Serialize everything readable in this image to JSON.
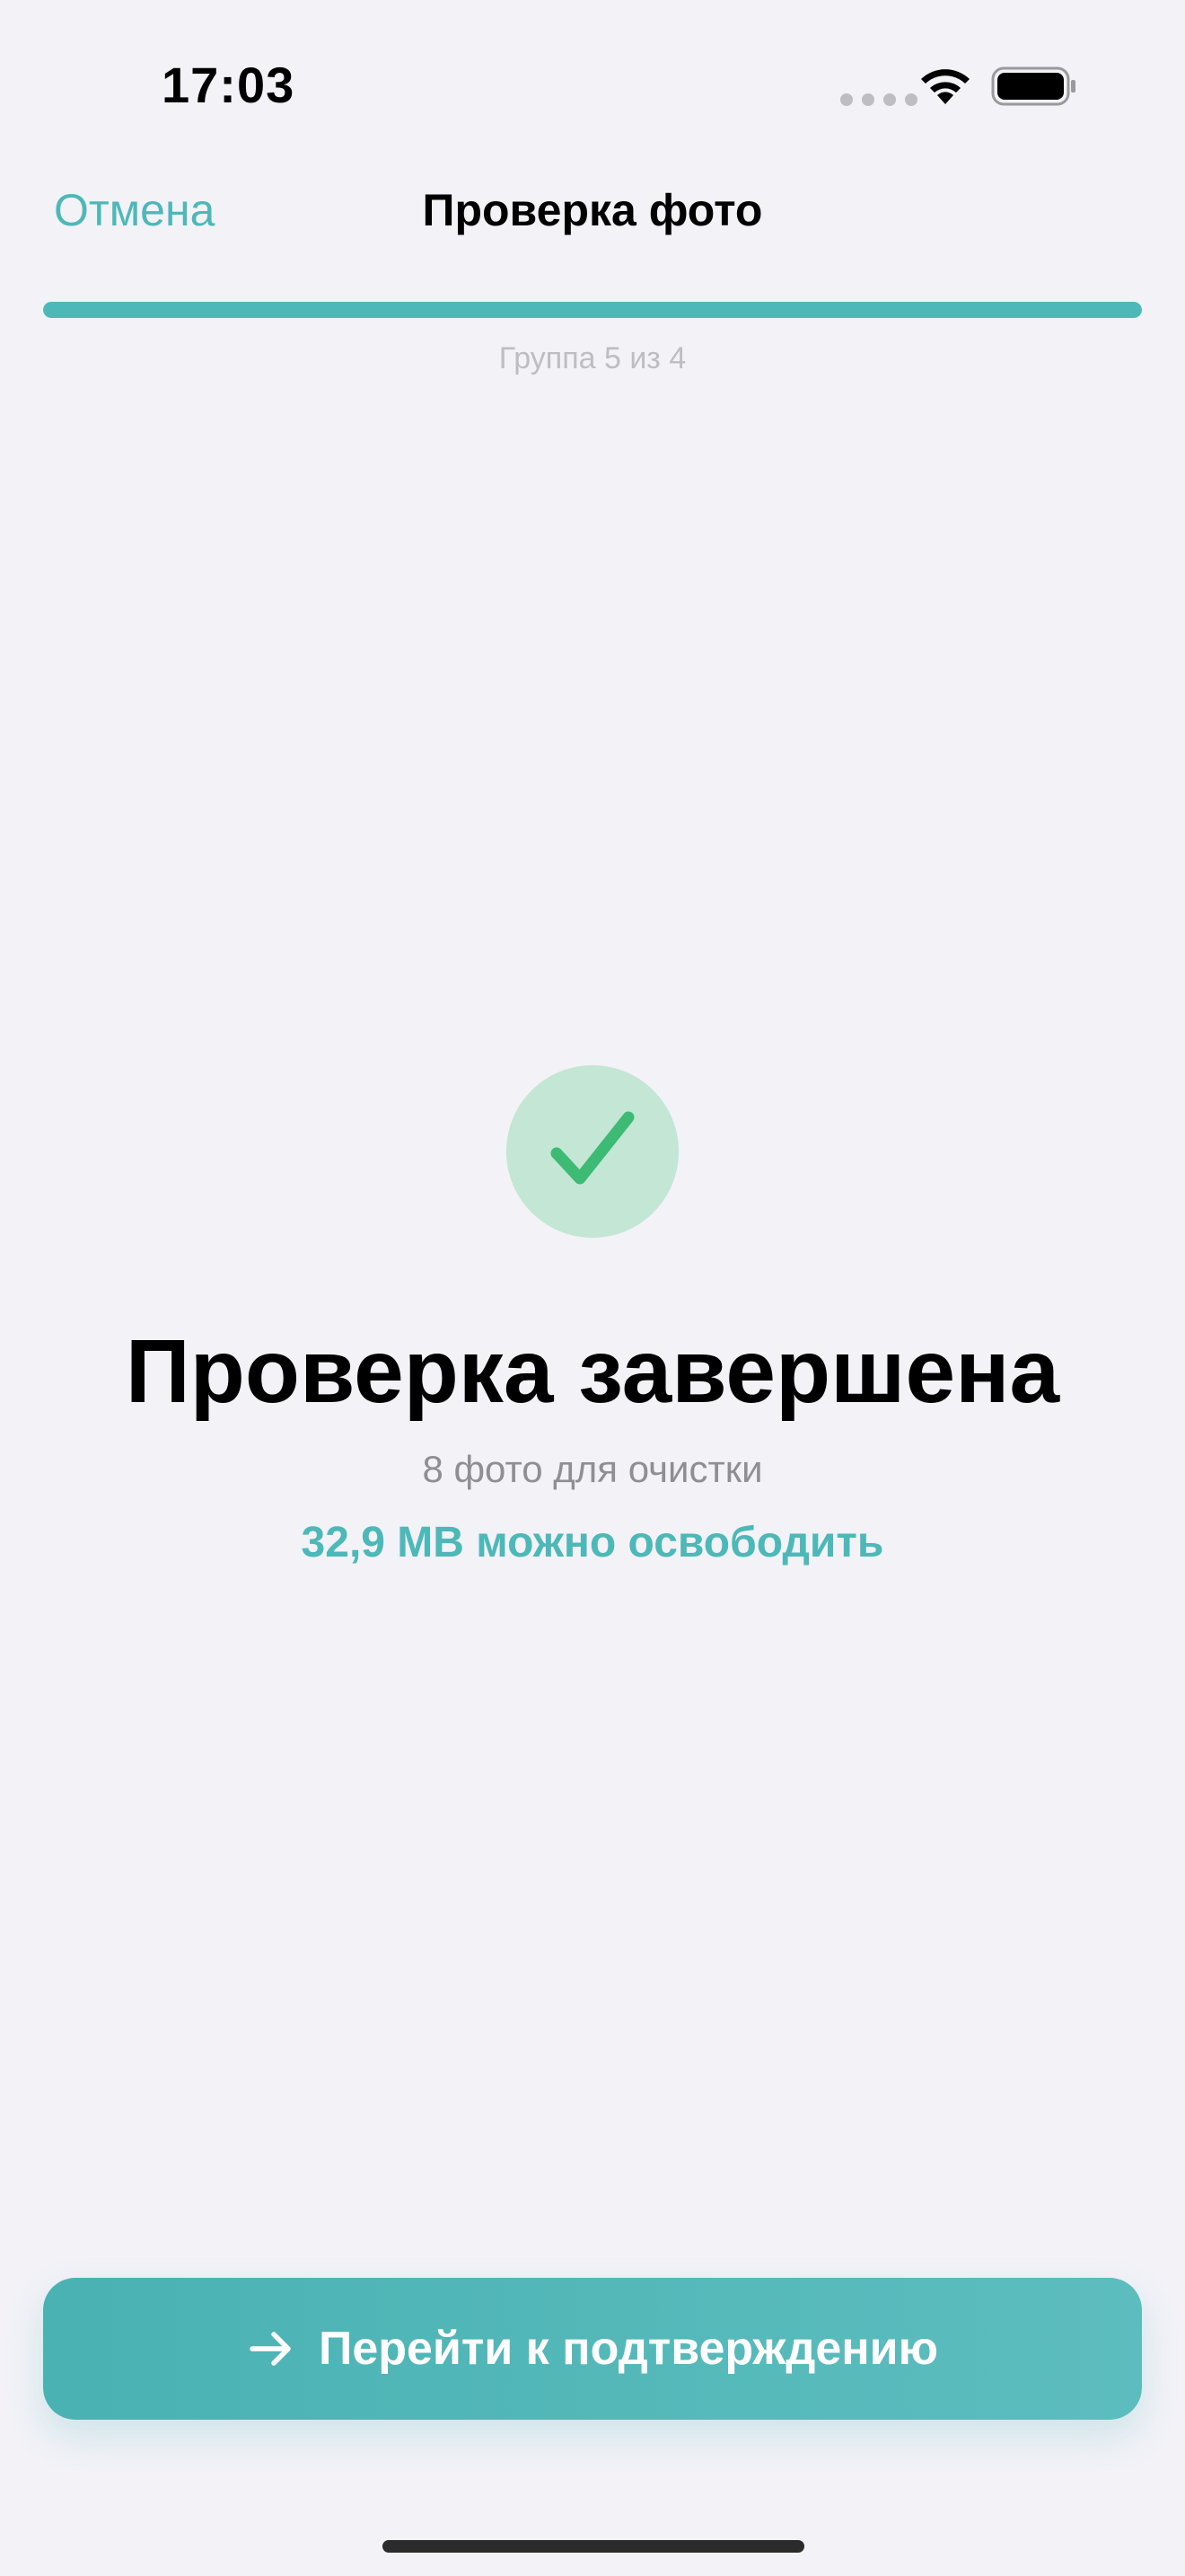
{
  "status_bar": {
    "time": "17:03",
    "icons": [
      "cellular-dots-icon",
      "wifi-icon",
      "battery-icon"
    ]
  },
  "nav": {
    "cancel_label": "Отмена",
    "title": "Проверка фото"
  },
  "progress": {
    "label": "Группа 5 из 4",
    "fraction": 1.0
  },
  "result": {
    "icon": "checkmark-icon",
    "headline": "Проверка завершена",
    "subline": "8 фото для очистки",
    "savings": "32,9 MB можно освободить"
  },
  "action": {
    "icon": "arrow-right-icon",
    "label": "Перейти к подтверждению"
  },
  "colors": {
    "accent": "#4DB8B8",
    "background": "#F2F2F7",
    "success": "#3DBA74",
    "success_bg": "#C3E6D5",
    "secondary_text": "#8E8E93"
  }
}
